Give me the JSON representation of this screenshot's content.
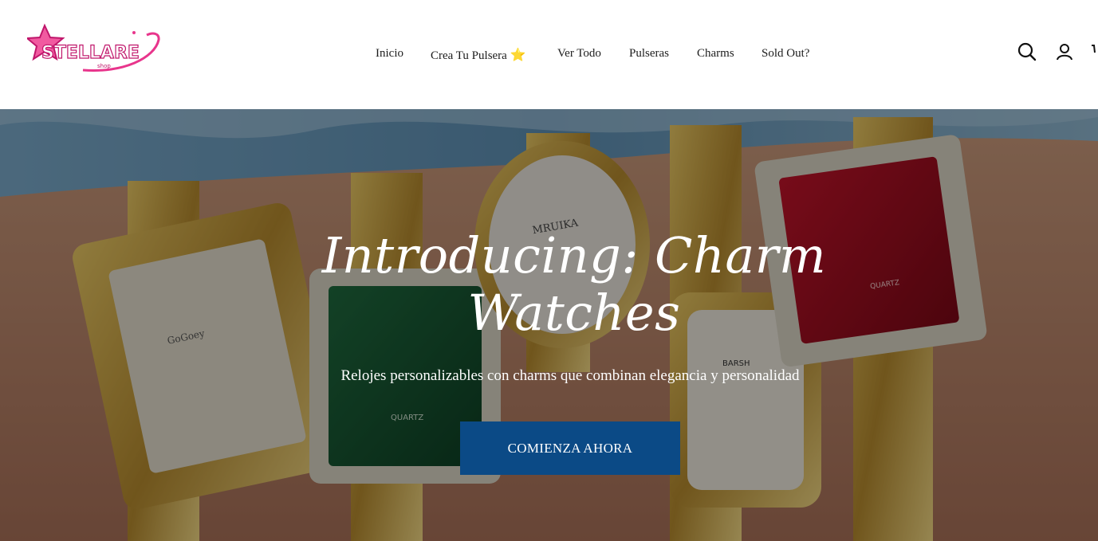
{
  "brand": {
    "logo_text": "STELLARE",
    "logo_sub": "shop",
    "accent": "#e8358c"
  },
  "nav": {
    "items": [
      {
        "label": "Inicio"
      },
      {
        "label": "Crea Tu Pulsera"
      },
      {
        "label": "Ver Todo"
      },
      {
        "label": "Pulseras"
      },
      {
        "label": "Charms"
      },
      {
        "label": "Sold Out?"
      }
    ],
    "star_glyph": "⭐"
  },
  "header_icons": [
    "search-icon",
    "account-icon",
    "cart-icon"
  ],
  "hero": {
    "title": "Introducing: Charm Watches",
    "subtitle": "Relojes personalizables con charms que combinan elegancia y personalidad",
    "cta_label": "COMIENZA AHORA",
    "cta_color": "#0b4a86",
    "watch_texts": [
      "GoGoey",
      "QUARTZ",
      "MRUIKA",
      "QUARTZ",
      "BARSH",
      "QUARTZ",
      "QUARTZ"
    ]
  }
}
